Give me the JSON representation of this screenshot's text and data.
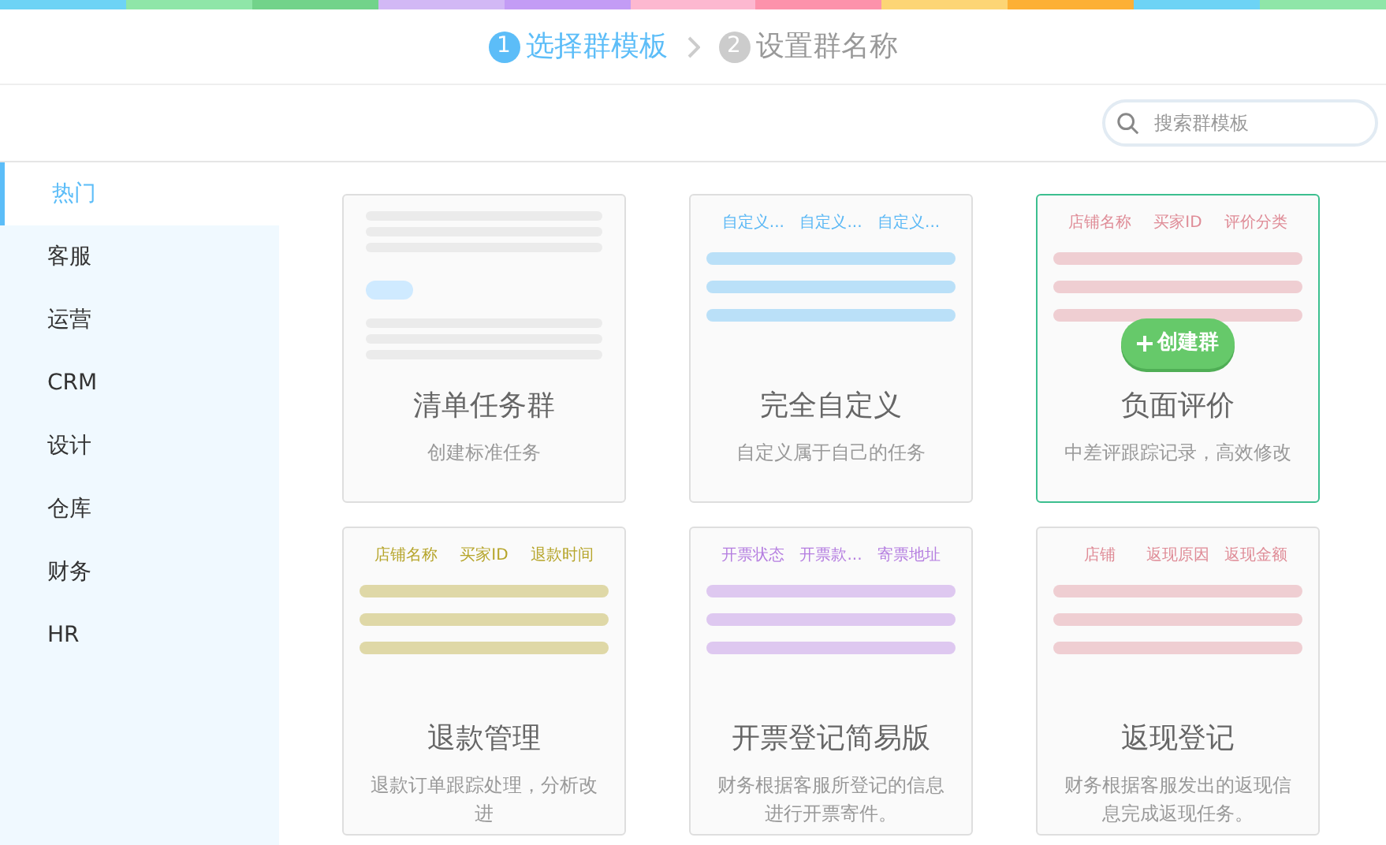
{
  "steps": [
    {
      "number": "1",
      "label": "选择群模板",
      "selected": true
    },
    {
      "number": "2",
      "label": "设置群名称",
      "selected": false
    }
  ],
  "search": {
    "placeholder": "搜索群模板"
  },
  "sidebar": {
    "items": [
      {
        "label": "热门",
        "selected": true
      },
      {
        "label": "客服",
        "selected": false
      },
      {
        "label": "运营",
        "selected": false
      },
      {
        "label": "CRM",
        "selected": false
      },
      {
        "label": "设计",
        "selected": false
      },
      {
        "label": "仓库",
        "selected": false
      },
      {
        "label": "财务",
        "selected": false
      },
      {
        "label": "HR",
        "selected": false
      }
    ]
  },
  "templates": [
    {
      "kind": "plain",
      "title": "清单任务群",
      "description": "创建标准任务",
      "hovered": false
    },
    {
      "kind": "columns",
      "color": "#5bb8f5",
      "columns": [
        "自定义...",
        "自定义...",
        "自定义..."
      ],
      "title": "完全自定义",
      "description": "自定义属于自己的任务",
      "hovered": false
    },
    {
      "kind": "columns",
      "color": "#df8c97",
      "columns": [
        "店铺名称",
        "买家ID",
        "评价分类"
      ],
      "title": "负面评价",
      "description": "中差评跟踪记录，高效修改",
      "hovered": true,
      "action": "创建群"
    },
    {
      "kind": "columns",
      "color": "#b6a52b",
      "columns": [
        "店铺名称",
        "买家ID",
        "退款时间"
      ],
      "title": "退款管理",
      "description": "退款订单跟踪处理，分析改进",
      "hovered": false
    },
    {
      "kind": "columns",
      "color": "#b57ee0",
      "columns": [
        "开票状态",
        "开票款...",
        "寄票地址"
      ],
      "title": "开票登记简易版",
      "description": "财务根据客服所登记的信息进行开票寄件。",
      "hovered": false
    },
    {
      "kind": "columns",
      "color": "#df8c97",
      "columns": [
        "店铺",
        "返现原因",
        "返现金额"
      ],
      "title": "返现登记",
      "description": "财务根据客服发出的返现信息完成返现任务。",
      "hovered": false
    }
  ]
}
